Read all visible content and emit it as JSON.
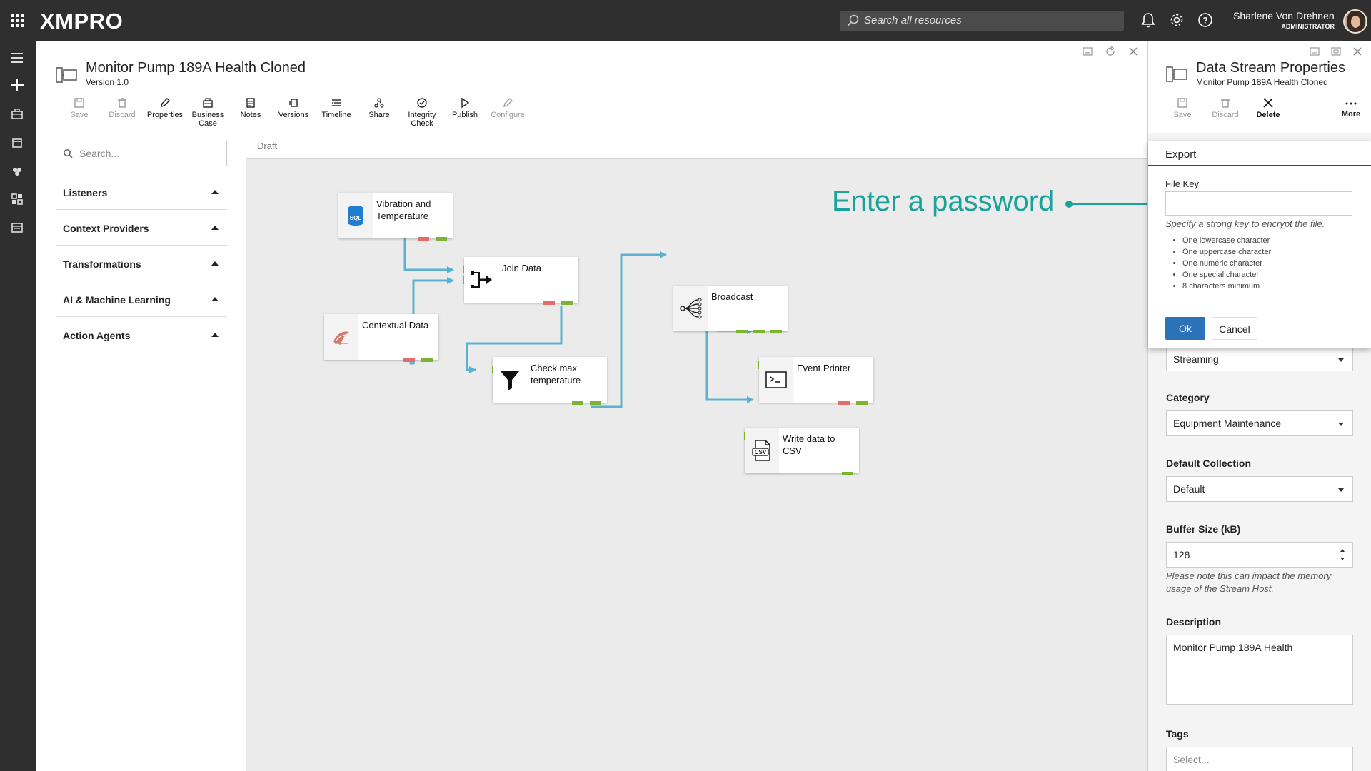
{
  "topbar": {
    "logo": "XMPRO",
    "search_placeholder": "Search all resources",
    "user_name": "Sharlene Von Drehnen",
    "user_role": "ADMINISTRATOR",
    "icons": [
      "apps-grid-icon",
      "bell-icon",
      "gear-icon",
      "help-icon",
      "avatar"
    ]
  },
  "leftrail": {
    "icons": [
      "menu-icon",
      "add-icon",
      "briefcase-icon",
      "calendar-icon",
      "agents-icon",
      "dashboard-icon",
      "apps-icon",
      "xmpro-x-icon"
    ]
  },
  "document": {
    "title": "Monitor Pump 189A Health Cloned",
    "version": "Version 1.0",
    "toolbar": [
      {
        "label": "Save",
        "disabled": true,
        "icon": "save-icon"
      },
      {
        "label": "Discard",
        "disabled": true,
        "icon": "trash-icon"
      },
      {
        "label": "Properties",
        "disabled": false,
        "icon": "pencil-icon"
      },
      {
        "label": "Business Case",
        "disabled": false,
        "icon": "briefcase-icon"
      },
      {
        "label": "Notes",
        "disabled": false,
        "icon": "notes-icon"
      },
      {
        "label": "Versions",
        "disabled": false,
        "icon": "versions-icon"
      },
      {
        "label": "Timeline",
        "disabled": false,
        "icon": "timeline-icon"
      },
      {
        "label": "Share",
        "disabled": false,
        "icon": "share-icon"
      },
      {
        "label": "Integrity Check",
        "disabled": false,
        "icon": "check-circle-icon"
      },
      {
        "label": "Publish",
        "disabled": false,
        "icon": "play-icon"
      },
      {
        "label": "Configure",
        "disabled": true,
        "icon": "wrench-icon"
      }
    ]
  },
  "toolbox": {
    "search_placeholder": "Search...",
    "categories": [
      "Listeners",
      "Context Providers",
      "Transformations",
      "AI & Machine Learning",
      "Action Agents"
    ]
  },
  "canvas": {
    "status": "Draft",
    "nodes": [
      {
        "id": "vibration",
        "label": "Vibration and Temperature",
        "icon": "sql-database-icon"
      },
      {
        "id": "contextual",
        "label": "Contextual Data",
        "icon": "sql-server-icon"
      },
      {
        "id": "join",
        "label": "Join Data",
        "icon": "join-icon"
      },
      {
        "id": "checkmax",
        "label": "Check max temperature",
        "icon": "filter-funnel-icon"
      },
      {
        "id": "broadcast",
        "label": "Broadcast",
        "icon": "broadcast-icon"
      },
      {
        "id": "printer",
        "label": "Event Printer",
        "icon": "terminal-icon"
      },
      {
        "id": "csv",
        "label": "Write data to CSV",
        "icon": "csv-file-icon"
      }
    ],
    "annotation": "Enter a password",
    "colors": {
      "wire": "#5bb1d1",
      "port_ok": "#7ab432",
      "port_err": "#e06c6c",
      "annotation": "#1aa39a"
    }
  },
  "properties_panel": {
    "title": "Data Stream Properties",
    "subtitle": "Monitor Pump 189A Health Cloned",
    "toolbar": [
      {
        "label": "Save",
        "disabled": true
      },
      {
        "label": "Discard",
        "disabled": true
      },
      {
        "label": "Delete",
        "disabled": false
      },
      {
        "label": "More",
        "disabled": false
      }
    ],
    "stream_type": "Streaming",
    "category_label": "Category",
    "category_value": "Equipment Maintenance",
    "collection_label": "Default Collection",
    "collection_value": "Default",
    "buffer_label": "Buffer Size (kB)",
    "buffer_value": "128",
    "buffer_note": "Please note this can impact the memory usage of the Stream Host.",
    "description_label": "Description",
    "description_value": "Monitor Pump 189A Health",
    "tags_label": "Tags",
    "tags_placeholder": "Select..."
  },
  "export_dialog": {
    "title": "Export",
    "file_key_label": "File Key",
    "file_key_value": "",
    "hint": "Specify a strong key to encrypt the file.",
    "rules": [
      "One lowercase character",
      "One uppercase character",
      "One numeric character",
      "One special character",
      "8 characters minimum"
    ],
    "ok_label": "Ok",
    "cancel_label": "Cancel",
    "accent": "#2c72b8"
  }
}
